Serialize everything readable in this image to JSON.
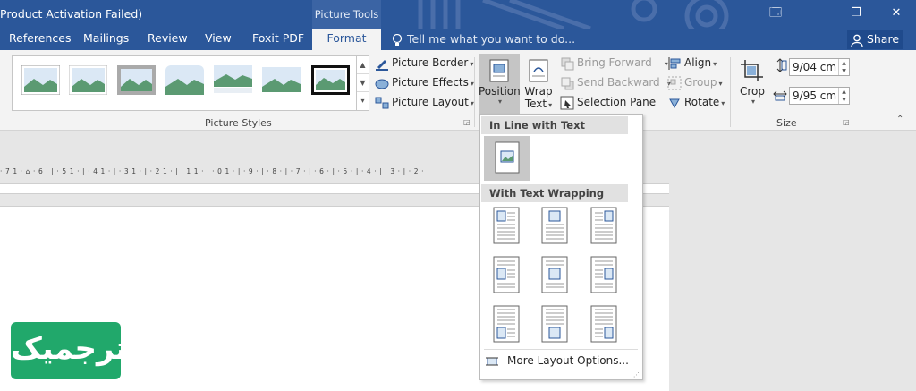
{
  "window": {
    "title": "Product Activation Failed)",
    "context_tab_group": "Picture Tools",
    "controls": [
      "🗔",
      "—",
      "❐",
      "✕"
    ]
  },
  "tabs": [
    {
      "label": "References"
    },
    {
      "label": "Mailings"
    },
    {
      "label": "Review"
    },
    {
      "label": "View"
    },
    {
      "label": "Foxit PDF"
    },
    {
      "label": "Format"
    }
  ],
  "tell_me": "Tell me what you want to do...",
  "share": "Share",
  "picture_styles": {
    "group_label": "Picture Styles",
    "border": "Picture Border",
    "effects": "Picture Effects",
    "layout": "Picture Layout"
  },
  "arrange": {
    "position": "Position",
    "wrap": "Wrap",
    "text": "Text",
    "bring_forward": "Bring Forward",
    "send_backward": "Send Backward",
    "selection_pane": "Selection Pane",
    "align": "Align",
    "group": "Group",
    "rotate": "Rotate"
  },
  "size": {
    "group_label": "Size",
    "crop": "Crop",
    "height": "9/04 cm",
    "width": "9/95 cm"
  },
  "ruler": "· 7 1 · ⌂ · 6 · | · 5 1 · | · 4 1 · | · 3 1 · | · 2 1 · | · 1 1 · | · 0 1 · | · 9 · | · 8 · | · 7 · | · 6 · | · 5 · | · 4 · | · 3 · | · 2 ·",
  "position_menu": {
    "inline_header": "In Line with Text",
    "wrap_header": "With Text Wrapping",
    "more": "More Layout Options..."
  },
  "logo_text": "ترجمیک"
}
